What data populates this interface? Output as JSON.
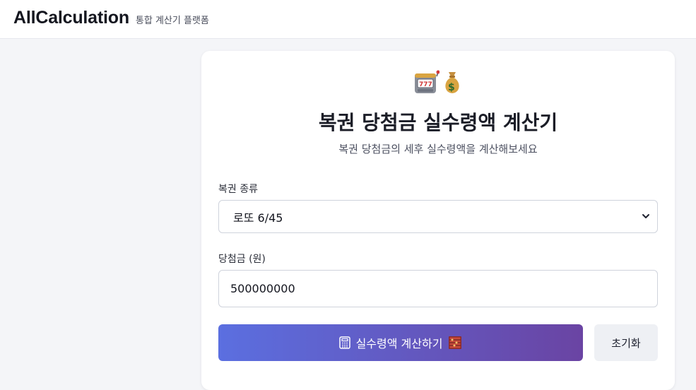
{
  "header": {
    "brand": "AllCalculation",
    "tagline": "통합 계산기 플랫폼"
  },
  "card": {
    "icons": [
      "slot-machine-icon",
      "money-bag-icon"
    ],
    "title": "복권 당첨금 실수령액 계산기",
    "subtitle": "복권 당첨금의 세후 실수령액을 계산해보세요",
    "lottery_type": {
      "label": "복권 종류",
      "selected": "로또 6/45"
    },
    "prize": {
      "label": "당첨금 (원)",
      "value": "500000000"
    },
    "calculate_button": "실수령액 계산하기",
    "reset_button": "초기화"
  },
  "colors": {
    "gradient_start": "#5b6fe0",
    "gradient_end": "#6a44a3",
    "card_background": "#ffffff",
    "page_background": "#f4f5f8"
  }
}
